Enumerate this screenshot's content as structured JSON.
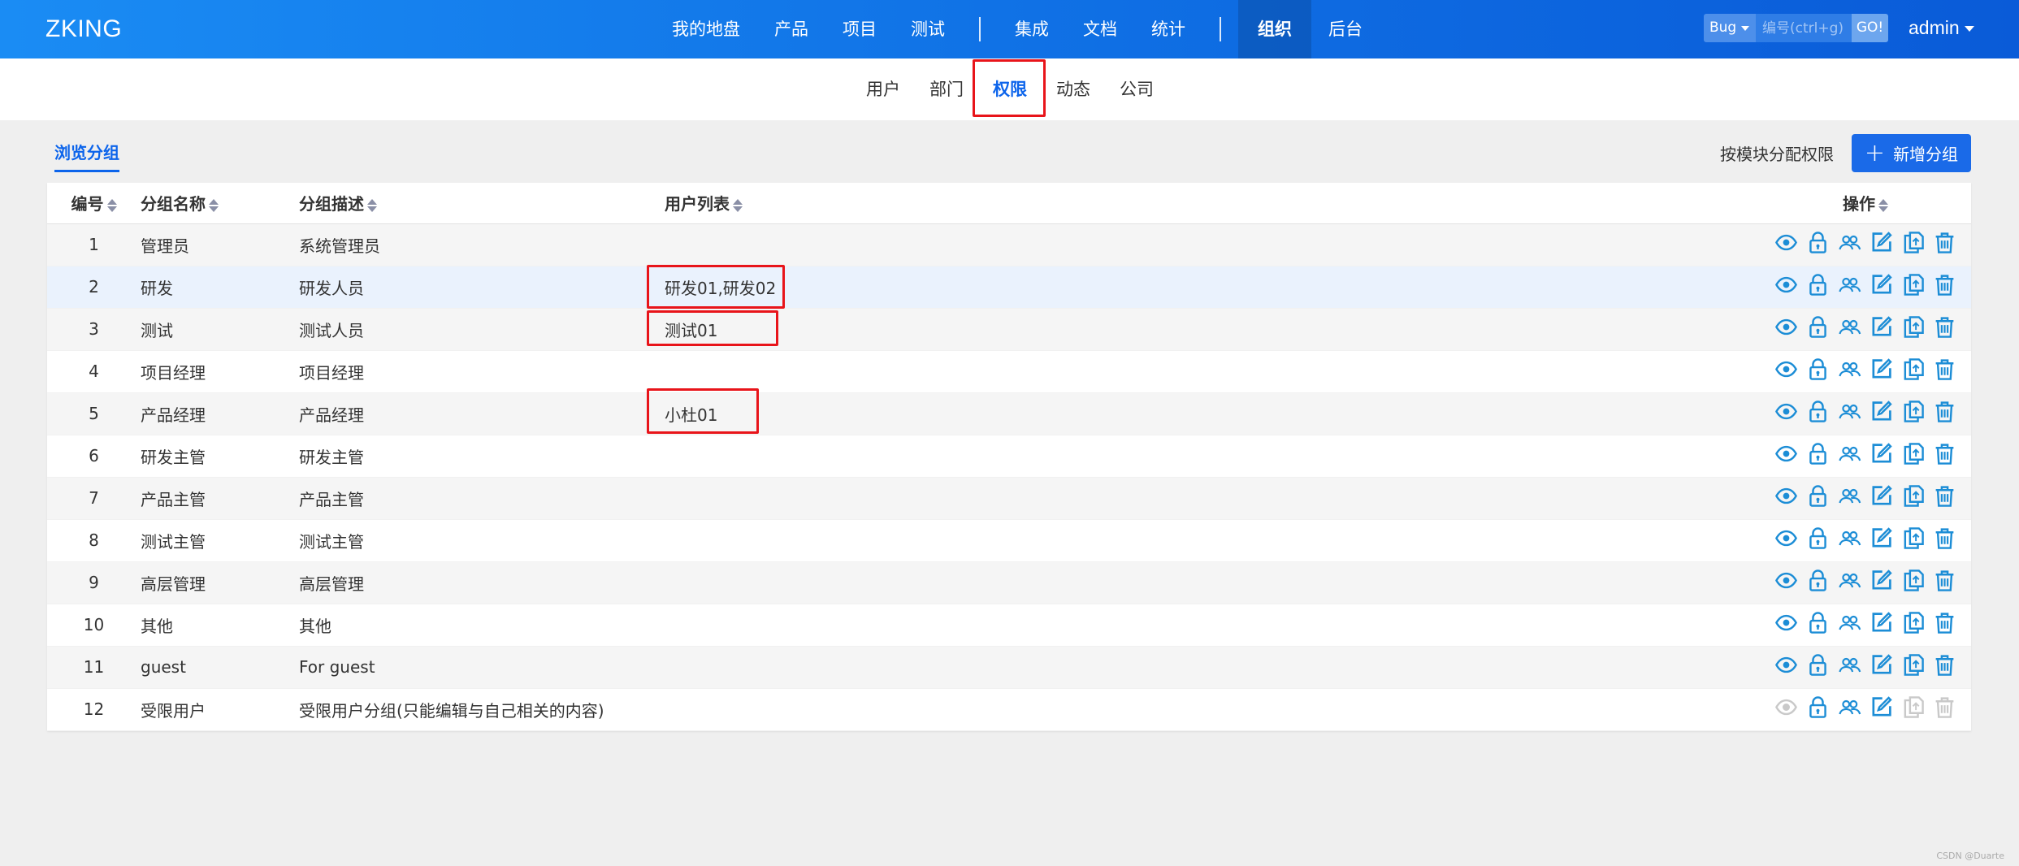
{
  "brand": "ZKING",
  "main_nav": [
    {
      "label": "我的地盘"
    },
    {
      "label": "产品"
    },
    {
      "label": "项目"
    },
    {
      "label": "测试"
    },
    {
      "label": "集成"
    },
    {
      "label": "文档"
    },
    {
      "label": "统计"
    },
    {
      "label": "组织"
    },
    {
      "label": "后台"
    }
  ],
  "search": {
    "type": "Bug",
    "placeholder": "编号(ctrl+g)",
    "go": "GO!"
  },
  "user": "admin",
  "sub_nav": [
    {
      "label": "用户"
    },
    {
      "label": "部门"
    },
    {
      "label": "权限"
    },
    {
      "label": "动态"
    },
    {
      "label": "公司"
    }
  ],
  "toolbar": {
    "tab": "浏览分组",
    "assign": "按模块分配权限",
    "add": "新增分组",
    "add_icon": "plus-icon"
  },
  "table": {
    "headers": {
      "id": "编号",
      "name": "分组名称",
      "desc": "分组描述",
      "users": "用户列表",
      "actions": "操作"
    },
    "rows": [
      {
        "id": "1",
        "name": "管理员",
        "desc": "系统管理员",
        "users": ""
      },
      {
        "id": "2",
        "name": "研发",
        "desc": "研发人员",
        "users": "研发01,研发02"
      },
      {
        "id": "3",
        "name": "测试",
        "desc": "测试人员",
        "users": "测试01"
      },
      {
        "id": "4",
        "name": "项目经理",
        "desc": "项目经理",
        "users": ""
      },
      {
        "id": "5",
        "name": "产品经理",
        "desc": "产品经理",
        "users": "小杜01"
      },
      {
        "id": "6",
        "name": "研发主管",
        "desc": "研发主管",
        "users": ""
      },
      {
        "id": "7",
        "name": "产品主管",
        "desc": "产品主管",
        "users": ""
      },
      {
        "id": "8",
        "name": "测试主管",
        "desc": "测试主管",
        "users": ""
      },
      {
        "id": "9",
        "name": "高层管理",
        "desc": "高层管理",
        "users": ""
      },
      {
        "id": "10",
        "name": "其他",
        "desc": "其他",
        "users": ""
      },
      {
        "id": "11",
        "name": "guest",
        "desc": "For guest",
        "users": ""
      },
      {
        "id": "12",
        "name": "受限用户",
        "desc": "受限用户分组(只能编辑与自己相关的内容)",
        "users": ""
      }
    ]
  },
  "action_icons": [
    "eye-icon",
    "lock-icon",
    "users-icon",
    "edit-icon",
    "copy-icon",
    "delete-icon"
  ],
  "colors": {
    "accent": "#0c64eb",
    "icon": "#1c8dd6",
    "highlight": "#e8141a",
    "disabled": "#c9c9c9"
  },
  "watermark": "CSDN @Duarte"
}
